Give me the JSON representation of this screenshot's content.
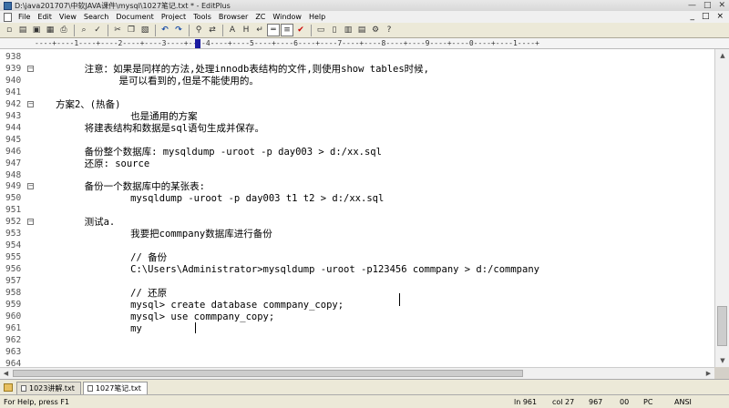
{
  "window": {
    "title": "D:\\java201707\\中软JAVA课件\\mysql\\1027笔记.txt * - EditPlus",
    "controls": [
      "—",
      "□",
      "✕"
    ]
  },
  "menu": {
    "items": [
      "File",
      "Edit",
      "View",
      "Search",
      "Document",
      "Project",
      "Tools",
      "Browser",
      "ZC",
      "Window",
      "Help"
    ],
    "doc_controls": [
      "_",
      "□",
      "×"
    ]
  },
  "toolbar": {
    "buttons": [
      {
        "name": "new-file-icon",
        "glyph": "▫"
      },
      {
        "name": "open-file-icon",
        "glyph": "▤"
      },
      {
        "name": "save-icon",
        "glyph": "▣"
      },
      {
        "name": "save-all-icon",
        "glyph": "▦"
      },
      {
        "name": "print-icon",
        "glyph": "⎙"
      },
      {
        "name": "print-preview-icon",
        "glyph": "⌕"
      },
      {
        "name": "spellcheck-icon",
        "glyph": "✓"
      },
      {
        "name": "cut-icon",
        "glyph": "✂"
      },
      {
        "name": "copy-icon",
        "glyph": "❐"
      },
      {
        "name": "paste-icon",
        "glyph": "▧"
      },
      {
        "name": "undo-icon",
        "glyph": "↶"
      },
      {
        "name": "redo-icon",
        "glyph": "↷"
      },
      {
        "name": "find-icon",
        "glyph": "⚲"
      },
      {
        "name": "replace-icon",
        "glyph": "⇄"
      },
      {
        "name": "font-size-icon",
        "glyph": "A"
      },
      {
        "name": "hex-icon",
        "glyph": "H"
      },
      {
        "name": "word-wrap-icon",
        "glyph": "↵"
      },
      {
        "name": "ruler-icon",
        "glyph": "═"
      },
      {
        "name": "line-number-icon",
        "glyph": "≡"
      },
      {
        "name": "check-icon",
        "glyph": "✔"
      },
      {
        "name": "browser-icon",
        "glyph": "▭"
      },
      {
        "name": "cliptext-icon",
        "glyph": "▯"
      },
      {
        "name": "directory-icon",
        "glyph": "▥"
      },
      {
        "name": "output-icon",
        "glyph": "▤"
      },
      {
        "name": "settings-icon",
        "glyph": "⚙"
      },
      {
        "name": "help-icon",
        "glyph": "?"
      }
    ]
  },
  "ruler": {
    "scale": "----+----1----+----2----+----3----+----4----+----5----+----6----+----7----+----8----+----9----+----0----+----1----+"
  },
  "editor": {
    "lines": [
      {
        "num": "938",
        "fold": "",
        "text": ""
      },
      {
        "num": "939",
        "fold": "⊟",
        "text": "        注意：如果是同样的方法,处理innodb表结构的文件,则使用show tables时候,"
      },
      {
        "num": "940",
        "fold": "",
        "text": "              是可以看到的,但是不能使用的。"
      },
      {
        "num": "941",
        "fold": "",
        "text": ""
      },
      {
        "num": "942",
        "fold": "⊟",
        "text": "   方案2、(热备)"
      },
      {
        "num": "943",
        "fold": "",
        "text": "                也是通用的方案"
      },
      {
        "num": "944",
        "fold": "",
        "text": "        将建表结构和数据是sql语句生成并保存。"
      },
      {
        "num": "945",
        "fold": "",
        "text": ""
      },
      {
        "num": "946",
        "fold": "",
        "text": "        备份整个数据库: mysqldump -uroot -p day003 > d:/xx.sql"
      },
      {
        "num": "947",
        "fold": "",
        "text": "        还原: source"
      },
      {
        "num": "948",
        "fold": "",
        "text": ""
      },
      {
        "num": "949",
        "fold": "⊟",
        "text": "        备份一个数据库中的某张表:"
      },
      {
        "num": "950",
        "fold": "",
        "text": "                mysqldump -uroot -p day003 t1 t2 > d:/xx.sql"
      },
      {
        "num": "951",
        "fold": "",
        "text": ""
      },
      {
        "num": "952",
        "fold": "⊟",
        "text": "        测试a."
      },
      {
        "num": "953",
        "fold": "",
        "text": "                我要把commpany数据库进行备份"
      },
      {
        "num": "954",
        "fold": "",
        "text": ""
      },
      {
        "num": "955",
        "fold": "",
        "text": "                // 备份"
      },
      {
        "num": "956",
        "fold": "",
        "text": "                C:\\Users\\Administrator>mysqldump -uroot -p123456 commpany > d:/commpany"
      },
      {
        "num": "957",
        "fold": "",
        "text": ""
      },
      {
        "num": "958",
        "fold": "",
        "text": "                // 还原"
      },
      {
        "num": "959",
        "fold": "",
        "text": "                mysql> create database commpany_copy;"
      },
      {
        "num": "960",
        "fold": "",
        "text": "                mysql> use commpany_copy;"
      },
      {
        "num": "961",
        "fold": "",
        "text": "                my"
      },
      {
        "num": "962",
        "fold": "",
        "text": ""
      },
      {
        "num": "963",
        "fold": "",
        "text": ""
      },
      {
        "num": "964",
        "fold": "",
        "text": ""
      }
    ]
  },
  "tabs": [
    {
      "label": "1023讲解.txt",
      "active": false
    },
    {
      "label": "1027笔记.txt",
      "active": true
    }
  ],
  "status": {
    "help": "For Help, press F1",
    "ln": "ln 961",
    "col": "col 27",
    "chars": "967",
    "code": "00",
    "mode": "PC",
    "encoding": "ANSI"
  }
}
